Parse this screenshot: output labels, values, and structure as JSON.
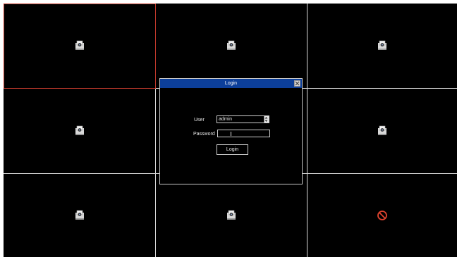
{
  "grid": {
    "cells": [
      {
        "status": "camera-icon",
        "selected": true
      },
      {
        "status": "camera-icon",
        "selected": false
      },
      {
        "status": "camera-icon",
        "selected": false
      },
      {
        "status": "camera-icon",
        "selected": false
      },
      {
        "status": "hidden-by-dialog",
        "selected": false
      },
      {
        "status": "camera-icon",
        "selected": false
      },
      {
        "status": "camera-icon",
        "selected": false
      },
      {
        "status": "camera-icon",
        "selected": false
      },
      {
        "status": "no-signal-icon",
        "selected": false
      }
    ]
  },
  "login_dialog": {
    "title": "Login",
    "user_label": "User",
    "user_value": "admin",
    "password_label": "Password",
    "password_value": "",
    "login_button": "Login"
  },
  "colors": {
    "background": "#000000",
    "grid_line": "#d8d8d8",
    "selected_border": "#c0392b",
    "title_bar": "#0c3f9a",
    "no_signal": "#e0442f"
  }
}
